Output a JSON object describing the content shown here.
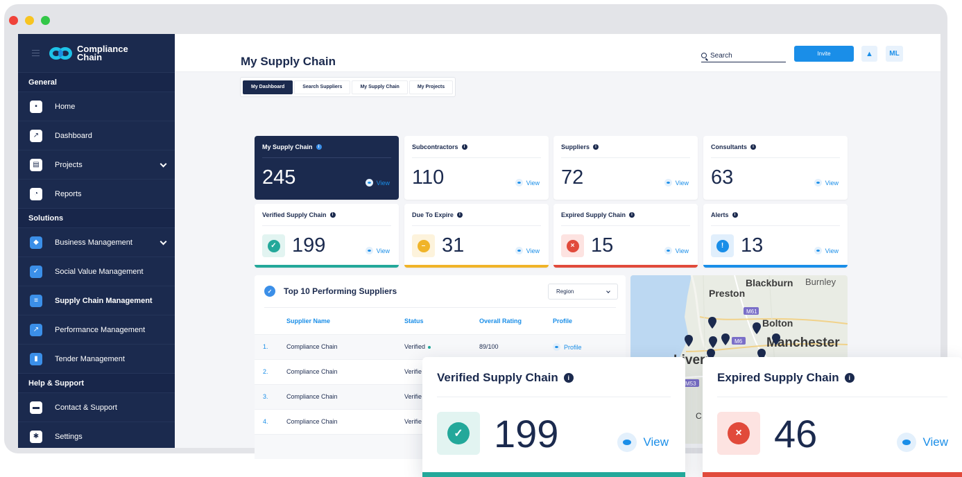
{
  "brand": {
    "line1": "Compliance",
    "line2": "Chain"
  },
  "colors": {
    "navy": "#1b2a4e",
    "accent": "#1a8ee8",
    "teal": "#23a89a",
    "amber": "#f0b429",
    "red": "#e14a3b"
  },
  "sidebar": {
    "general_label": "General",
    "general": [
      {
        "label": "Home",
        "icon": "grid-icon"
      },
      {
        "label": "Dashboard",
        "icon": "chart-icon"
      },
      {
        "label": "Projects",
        "icon": "building-icon"
      },
      {
        "label": "Reports",
        "icon": "pie-icon"
      }
    ],
    "solutions_label": "Solutions",
    "solutions": [
      {
        "label": "Business Management",
        "icon": "shield-icon"
      },
      {
        "label": "Social Value Management",
        "icon": "check-icon"
      },
      {
        "label": "Supply Chain Management",
        "icon": "list-icon"
      },
      {
        "label": "Performance Management",
        "icon": "arrow-icon"
      },
      {
        "label": "Tender Management",
        "icon": "doc-icon"
      }
    ],
    "help_label": "Help & Support",
    "help": [
      {
        "label": "Contact & Support",
        "icon": "chat-icon"
      },
      {
        "label": "Settings",
        "icon": "gear-icon"
      }
    ]
  },
  "topbar": {
    "search_label": "Search",
    "invite_label": "Invite",
    "avatar_initials": "ML"
  },
  "page": {
    "title": "My Supply Chain",
    "tabs": [
      "My Dashboard",
      "Search Suppliers",
      "My Supply Chain",
      "My Projects"
    ]
  },
  "cards": {
    "view_label": "View",
    "my_supply_chain": {
      "title": "My Supply Chain",
      "value": "245"
    },
    "subcontractors": {
      "title": "Subcontractors",
      "value": "110"
    },
    "suppliers": {
      "title": "Suppliers",
      "value": "72"
    },
    "consultants": {
      "title": "Consultants",
      "value": "63"
    },
    "verified": {
      "title": "Verified Supply Chain",
      "value": "199"
    },
    "due": {
      "title": "Due To Expire",
      "value": "31"
    },
    "expired": {
      "title": "Expired Supply Chain",
      "value": "15"
    },
    "alerts": {
      "title": "Alerts",
      "value": "13"
    }
  },
  "suppliers_table": {
    "title": "Top 10 Performing Suppliers",
    "region_label": "Region",
    "headers": [
      "Supplier Name",
      "Status",
      "Overall Rating",
      "Profile"
    ],
    "rows": [
      {
        "num": "1.",
        "name": "Compliance Chain",
        "status": "Verified",
        "rating": "89/100",
        "profile": "Profile"
      },
      {
        "num": "2.",
        "name": "Compliance Chain",
        "status": "Verifie"
      },
      {
        "num": "3.",
        "name": "Compliance Chain",
        "status": "Verifie"
      },
      {
        "num": "4.",
        "name": "Compliance Chain",
        "status": "Verifie"
      }
    ]
  },
  "map": {
    "labels": [
      "Blackburn",
      "Burnley",
      "Preston",
      "Bolton",
      "Manchester",
      "Liverp",
      "C"
    ],
    "road_labels": [
      "M61",
      "M6",
      "M53"
    ]
  },
  "big_cards": {
    "view_label": "View",
    "verified": {
      "title": "Verified Supply Chain",
      "value": "199"
    },
    "expired": {
      "title": "Expired Supply Chain",
      "value": "46"
    }
  }
}
